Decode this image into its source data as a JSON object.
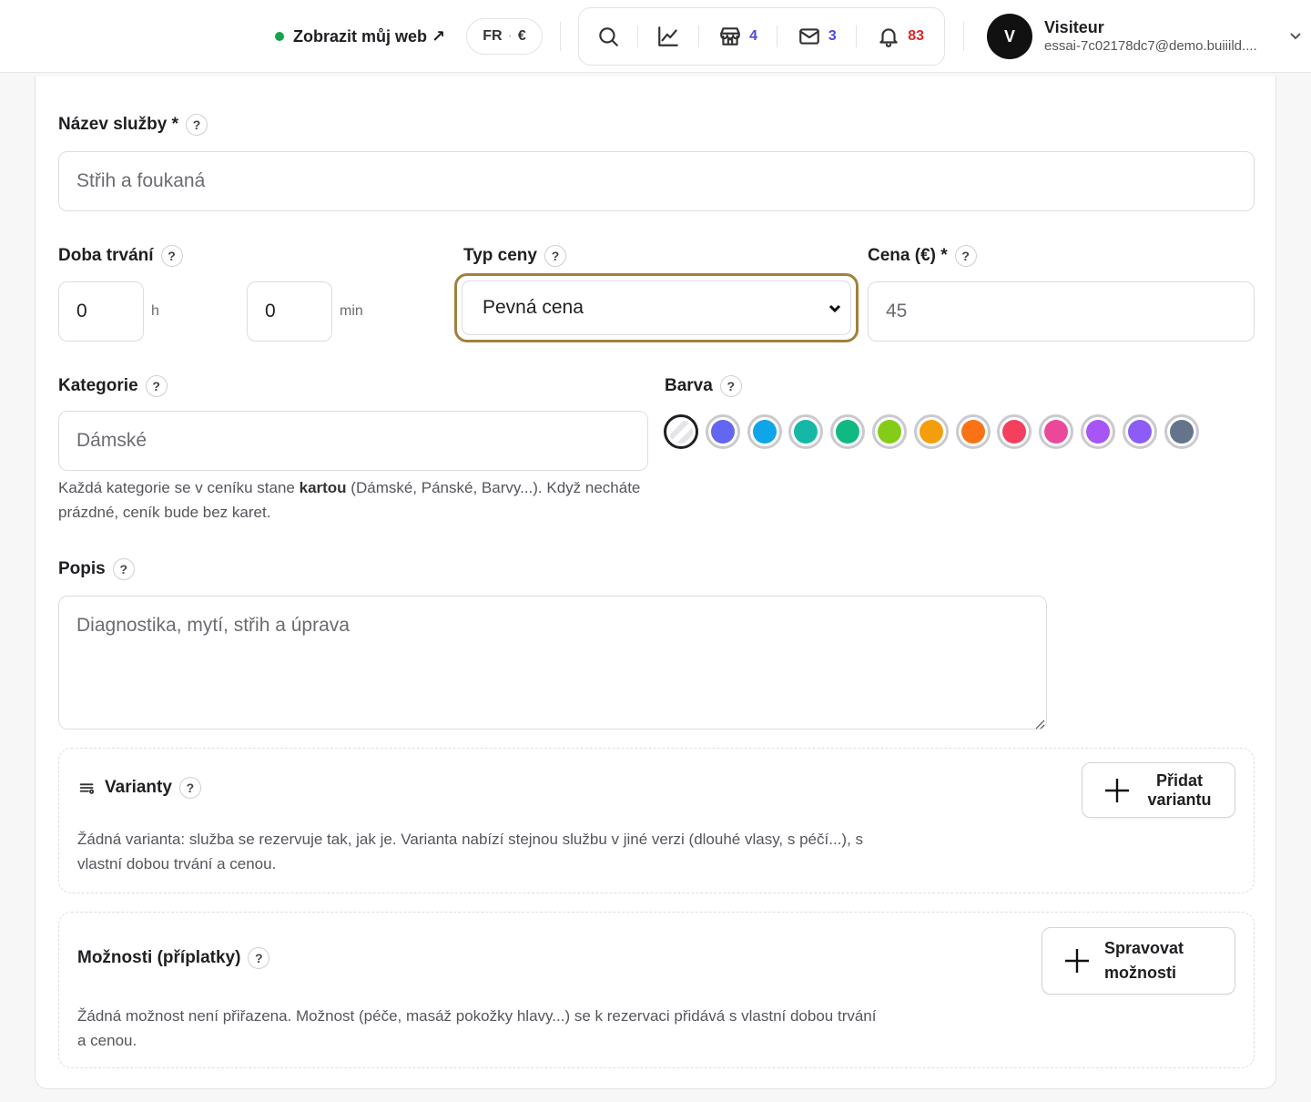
{
  "header": {
    "site_link": "Zobrazit můj web ↗",
    "lang": "FR",
    "currency": "€",
    "shop_count": "4",
    "mail_count": "3",
    "notif_count": "83",
    "user": {
      "initial": "V",
      "name": "Visiteur",
      "email": "essai-7c02178dc7@demo.buiiild...."
    }
  },
  "form": {
    "name": {
      "label": "Název služby *",
      "help": "?",
      "placeholder": "Střih a foukaná"
    },
    "duration": {
      "label": "Doba trvání",
      "help": "?",
      "hours_value": "0",
      "hours_unit": "h",
      "minutes_value": "0",
      "minutes_unit": "min"
    },
    "price_type": {
      "label": "Typ ceny",
      "help": "?",
      "selected": "Pevná cena"
    },
    "price": {
      "label": "Cena (€) *",
      "help": "?",
      "placeholder": "45"
    },
    "category": {
      "label": "Kategorie",
      "help": "?",
      "placeholder": "Dámské",
      "hint_before": "Každá kategorie se v ceníku stane ",
      "hint_bold": "kartou",
      "hint_after": " (Dámské, Pánské, Barvy...). Když necháte prázdné, ceník bude bez karet."
    },
    "color": {
      "label": "Barva",
      "help": "?",
      "swatches": [
        "none",
        "#6366f1",
        "#0ea5e9",
        "#14b8a6",
        "#10b981",
        "#84cc16",
        "#f59e0b",
        "#f97316",
        "#f43f5e",
        "#ec4899",
        "#a855f7",
        "#8b5cf6",
        "#64748b"
      ]
    },
    "description": {
      "label": "Popis",
      "help": "?",
      "placeholder": "Diagnostika, mytí, střih a úprava"
    },
    "variants": {
      "title": "Varianty",
      "help": "?",
      "button": "Přidat variantu",
      "text": "Žádná varianta: služba se rezervuje tak, jak je. Varianta nabízí stejnou službu v jiné verzi (dlouhé vlasy, s péčí...), s vlastní dobou trvání a cenou."
    },
    "options": {
      "title": "Možnosti (příplatky)",
      "help": "?",
      "button": "Spravovat možnosti",
      "text": "Žádná možnost není přiřazena. Možnost (péče, masáž pokožky hlavy...) se k rezervaci přidává s vlastní dobou trvání a cenou."
    }
  }
}
